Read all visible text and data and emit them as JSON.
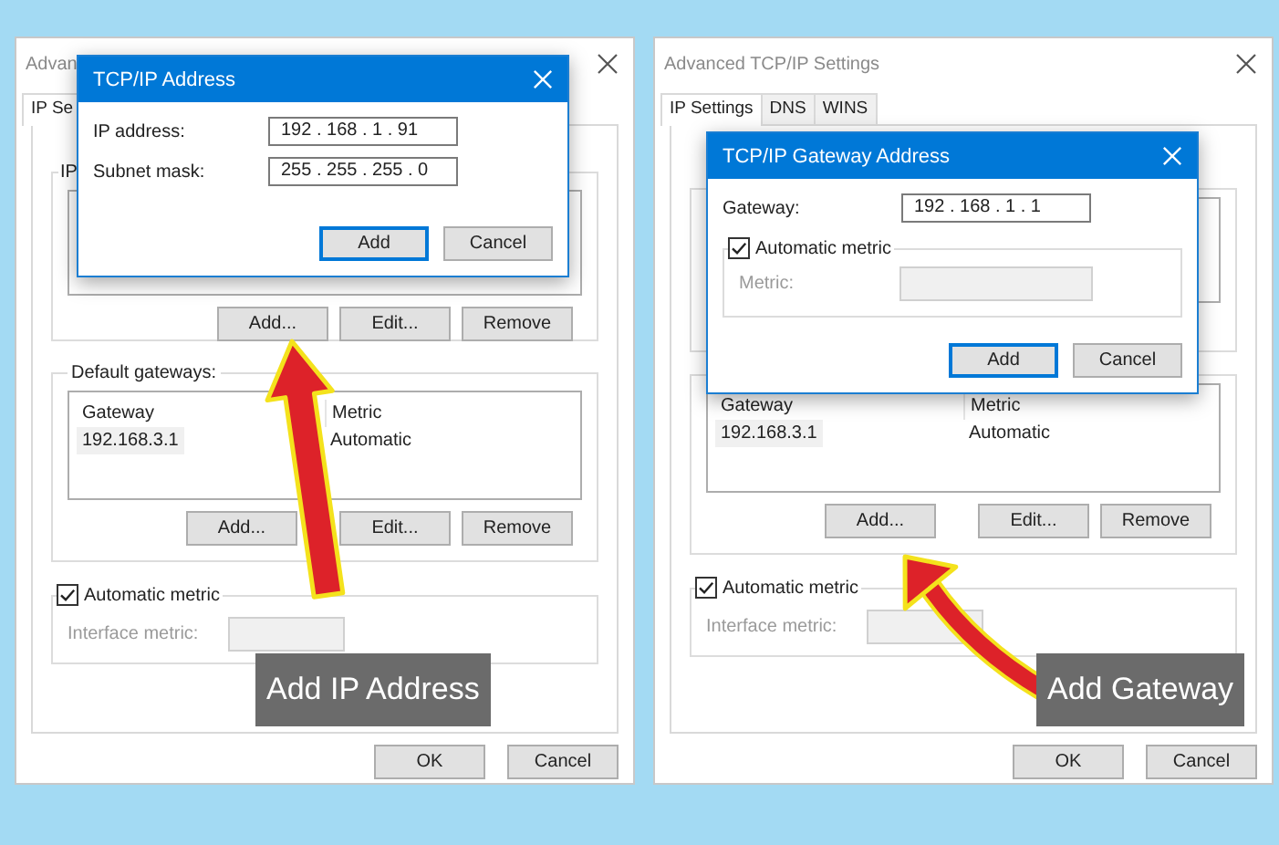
{
  "panels": [
    {
      "window": {
        "title": "Advan"
      },
      "tabs": [
        {
          "label": "IP Se",
          "selected": true
        }
      ],
      "address_group": {
        "label": "IP",
        "buttons": [
          "Add...",
          "Edit...",
          "Remove"
        ]
      },
      "gateways_group": {
        "label": "Default gateways:",
        "columns": [
          "Gateway",
          "Metric"
        ],
        "rows": [
          [
            "192.168.3.1",
            "Automatic"
          ]
        ],
        "buttons": [
          "Add...",
          "Edit...",
          "Remove"
        ]
      },
      "automatic_metric": {
        "label": "Automatic metric",
        "checked": true
      },
      "interface_metric": {
        "label": "Interface metric:",
        "disabled": true
      },
      "buttons": [
        "OK",
        "Cancel"
      ],
      "dialog": {
        "kind": "address",
        "title": "TCP/IP Address",
        "fields": [
          {
            "label": "IP address:",
            "value": "192 . 168 . 1 . 91"
          },
          {
            "label": "Subnet mask:",
            "value": "255 . 255 . 255 . 0"
          }
        ],
        "buttons": [
          {
            "label": "Add",
            "default": true
          },
          {
            "label": "Cancel",
            "default": false
          }
        ]
      },
      "callout": {
        "text": "Add IP Address",
        "kind": "straight"
      }
    },
    {
      "window": {
        "title": "Advanced TCP/IP Settings"
      },
      "tabs": [
        {
          "label": "IP Settings",
          "selected": true
        },
        {
          "label": "DNS",
          "selected": false
        },
        {
          "label": "WINS",
          "selected": false
        }
      ],
      "gateways_group": {
        "columns": [
          "Gateway",
          "Metric"
        ],
        "rows": [
          [
            "192.168.3.1",
            "Automatic"
          ]
        ],
        "buttons": [
          "Add...",
          "Edit...",
          "Remove"
        ]
      },
      "automatic_metric": {
        "label": "Automatic metric",
        "checked": true
      },
      "interface_metric": {
        "label": "Interface metric:",
        "disabled": true
      },
      "buttons": [
        "OK",
        "Cancel"
      ],
      "dialog": {
        "kind": "gateway",
        "title": "TCP/IP Gateway Address",
        "fields": [
          {
            "label": "Gateway:",
            "value": "192 . 168 . 1 . 1"
          }
        ],
        "automatic_metric": {
          "label": "Automatic metric",
          "checked": true
        },
        "metric": {
          "label": "Metric:",
          "disabled": true
        },
        "buttons": [
          {
            "label": "Add",
            "default": true
          },
          {
            "label": "Cancel",
            "default": false
          }
        ]
      },
      "callout": {
        "text": "Add Gateway",
        "kind": "curved"
      }
    }
  ]
}
